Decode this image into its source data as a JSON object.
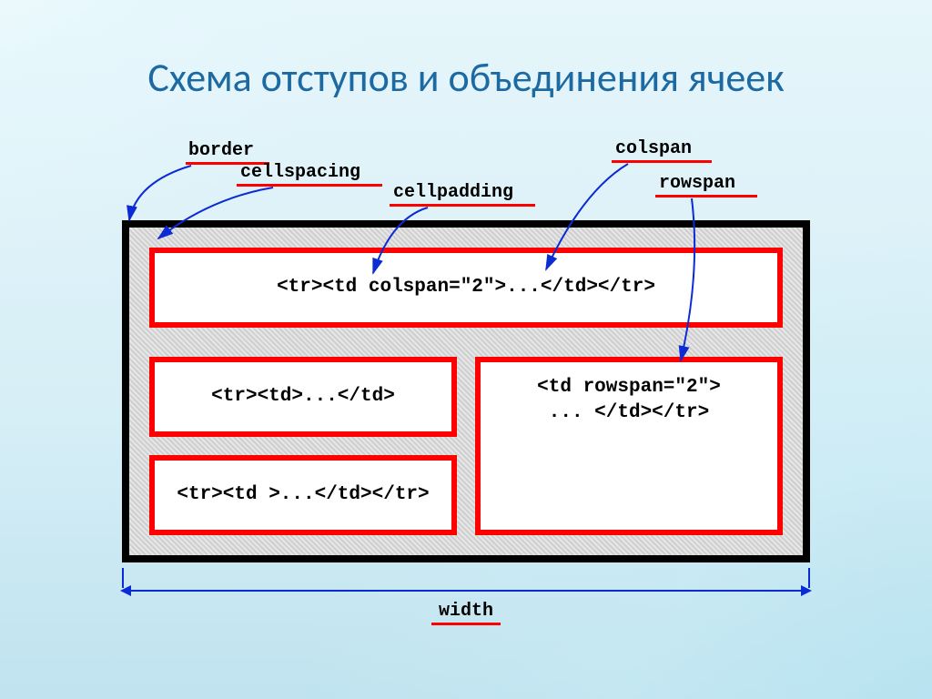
{
  "title": "Схема отступов и объединения ячеек",
  "labels": {
    "border": "border",
    "cellspacing": "cellspacing",
    "cellpadding": "cellpadding",
    "colspan": "colspan",
    "rowspan": "rowspan",
    "width": "width"
  },
  "cells": {
    "row1": "<tr><td colspan=\"2\">...</td></tr>",
    "row2": "<tr><td>...</td>",
    "row3": "<tr><td >...</td></tr>",
    "rowspan": "<td rowspan=\"2\">\n ... </td></tr>"
  },
  "colors": {
    "accent_red": "#ff0000",
    "arrow_blue": "#0b2bd5",
    "title_blue": "#1d6aa3"
  }
}
